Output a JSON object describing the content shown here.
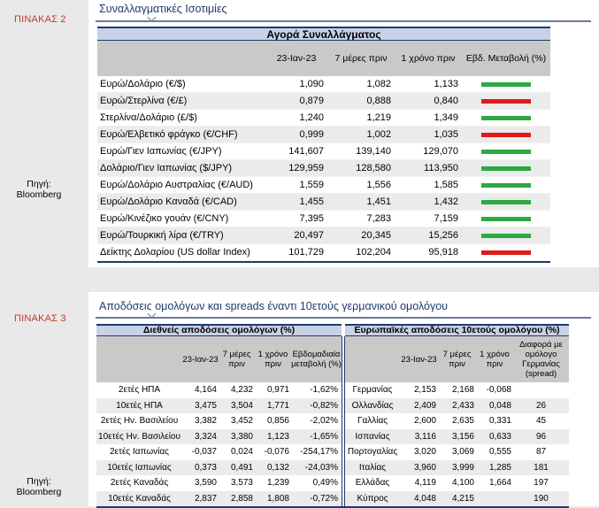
{
  "table2": {
    "label": "ΠΙΝΑΚΑΣ 2",
    "source_label": "Πηγή:",
    "source_name": "Bloomberg",
    "title": "Συναλλαγματικές Ισοτιμίες",
    "header": "Αγορά Συναλλάγματος",
    "columns": [
      "23-Ιαν-23",
      "7 μέρες πριν",
      "1 χρόνο πριν",
      "Εβδ. Μεταβολή (%)"
    ],
    "rows": [
      {
        "name": "Ευρώ/Δολάριο (€/$)",
        "v1": "1,090",
        "v2": "1,082",
        "v3": "1,133",
        "trend": "up"
      },
      {
        "name": "Ευρώ/Στερλίνα (€/£)",
        "v1": "0,879",
        "v2": "0,888",
        "v3": "0,840",
        "trend": "down"
      },
      {
        "name": "Στερλίνα/Δολάριο (£/$)",
        "v1": "1,240",
        "v2": "1,219",
        "v3": "1,349",
        "trend": "up"
      },
      {
        "name": "Ευρώ/Ελβετικό φράγκο (€/CHF)",
        "v1": "0,999",
        "v2": "1,002",
        "v3": "1,035",
        "trend": "down"
      },
      {
        "name": "Ευρώ/Γιεν Ιαπωνίας (€/JPY)",
        "v1": "141,607",
        "v2": "139,140",
        "v3": "129,070",
        "trend": "up"
      },
      {
        "name": "Δολάριο/Γιεν Ιαπωνίας ($/JPY)",
        "v1": "129,959",
        "v2": "128,580",
        "v3": "113,950",
        "trend": "up"
      },
      {
        "name": "Ευρώ/Δολάριο Αυστραλίας (€/AUD)",
        "v1": "1,559",
        "v2": "1,556",
        "v3": "1,585",
        "trend": "up"
      },
      {
        "name": "Ευρώ/Δολάριο Καναδά (€/CAD)",
        "v1": "1,455",
        "v2": "1,451",
        "v3": "1,432",
        "trend": "up"
      },
      {
        "name": "Ευρώ/Κινέζικο γουάν (€/CNY)",
        "v1": "7,395",
        "v2": "7,283",
        "v3": "7,159",
        "trend": "up"
      },
      {
        "name": "Ευρώ/Τουρκική λίρα (€/TRY)",
        "v1": "20,497",
        "v2": "20,345",
        "v3": "15,256",
        "trend": "up"
      },
      {
        "name": "Δείκτης Δολαρίου (US dollar Index)",
        "v1": "101,729",
        "v2": "102,204",
        "v3": "95,918",
        "trend": "down"
      }
    ]
  },
  "table3": {
    "label": "ΠΙΝΑΚΑΣ 3",
    "source_label": "Πηγή:",
    "source_name": "Bloomberg",
    "title": "Αποδόσεις ομολόγων και spreads έναντι 10ετούς γερμανικού ομολόγου",
    "left_header": "Διεθνείς αποδόσεις ομολόγων (%)",
    "right_header": "Ευρωπαϊκές αποδόσεις 10ετούς ομολόγου (%)",
    "left_columns": [
      "23-Ιαν-23",
      "7 μέρες πριν",
      "1 χρόνο πριν",
      "Εβδομαδιαία μεταβολή (%)"
    ],
    "right_columns": [
      "23-Ιαν-23",
      "7 μέρες πριν",
      "1 χρόνο πριν",
      "Διαφορά με ομόλογο Γερμανίας (spread)"
    ],
    "rows": [
      {
        "l": "2ετές ΗΠΑ",
        "a": "4,164",
        "b": "4,232",
        "c": "0,971",
        "d": "-1,62%",
        "r": "Γερμανίας",
        "e": "2,153",
        "f": "2,168",
        "g": "-0,068",
        "s": ""
      },
      {
        "l": "10ετές ΗΠΑ",
        "a": "3,475",
        "b": "3,504",
        "c": "1,771",
        "d": "-0,82%",
        "r": "Ολλανδίας",
        "e": "2,409",
        "f": "2,433",
        "g": "0,048",
        "s": "26"
      },
      {
        "l": "2ετές Ην. Βασιλείου",
        "a": "3,382",
        "b": "3,452",
        "c": "0,856",
        "d": "-2,02%",
        "r": "Γαλλίας",
        "e": "2,600",
        "f": "2,635",
        "g": "0,331",
        "s": "45"
      },
      {
        "l": "10ετές Ην. Βασιλείου",
        "a": "3,324",
        "b": "3,380",
        "c": "1,123",
        "d": "-1,65%",
        "r": "Ισπανίας",
        "e": "3,116",
        "f": "3,156",
        "g": "0,633",
        "s": "96"
      },
      {
        "l": "2ετές Ιαπωνίας",
        "a": "-0,037",
        "b": "0,024",
        "c": "-0,076",
        "d": "-254,17%",
        "r": "Πορτογαλίας",
        "e": "3,020",
        "f": "3,069",
        "g": "0,555",
        "s": "87"
      },
      {
        "l": "10ετές Ιαπωνίας",
        "a": "0,373",
        "b": "0,491",
        "c": "0,132",
        "d": "-24,03%",
        "r": "Ιταλίας",
        "e": "3,960",
        "f": "3,999",
        "g": "1,285",
        "s": "181"
      },
      {
        "l": "2ετές Καναδάς",
        "a": "3,590",
        "b": "3,573",
        "c": "1,239",
        "d": "0,49%",
        "r": "Ελλάδας",
        "e": "4,119",
        "f": "4,100",
        "g": "1,664",
        "s": "197"
      },
      {
        "l": "10ετές Καναδάς",
        "a": "2,837",
        "b": "2,858",
        "c": "1,808",
        "d": "-0,72%",
        "r": "Κύπρος",
        "e": "4,048",
        "f": "4,215",
        "g": "",
        "s": "190"
      }
    ]
  }
}
